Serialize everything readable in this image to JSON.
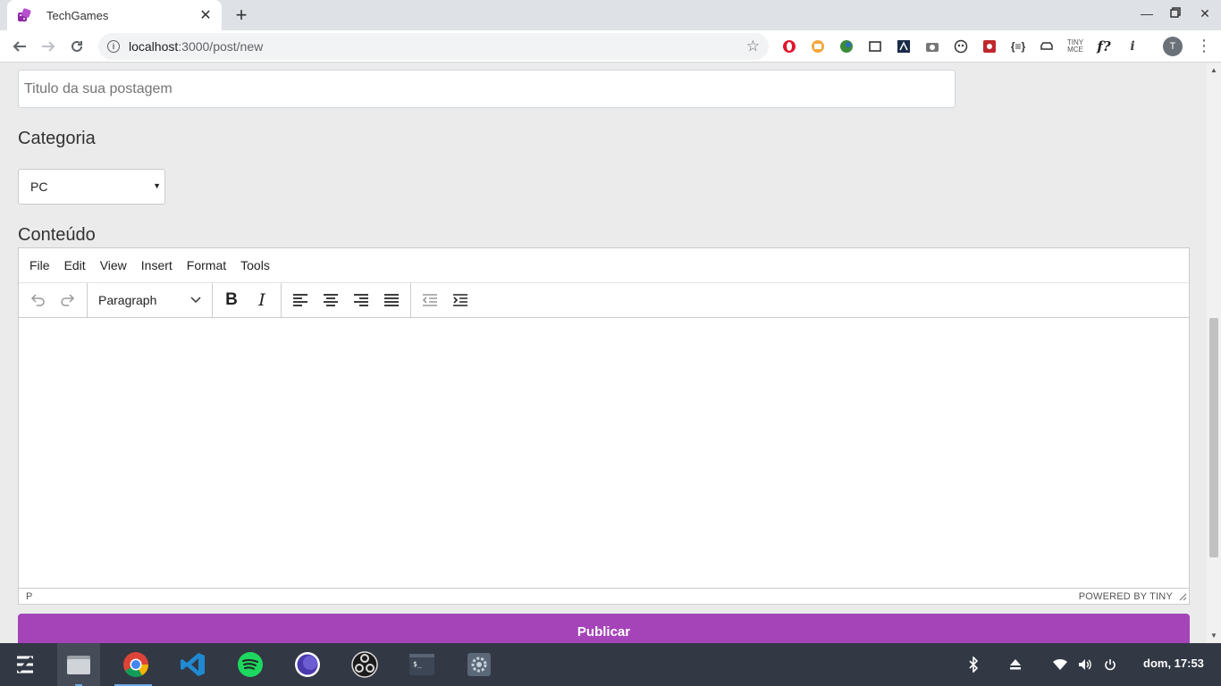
{
  "browser": {
    "tab_title": "TechGames",
    "url_host": "localhost",
    "url_path": ":3000/post/new",
    "avatar_letter": "T"
  },
  "page": {
    "title_placeholder": "Titulo da sua postagem",
    "category_label": "Categoria",
    "category_selected": "PC",
    "content_label": "Conteúdo",
    "publish_label": "Publicar"
  },
  "editor": {
    "menu": [
      "File",
      "Edit",
      "View",
      "Insert",
      "Format",
      "Tools"
    ],
    "format_select": "Paragraph",
    "status_path": "P",
    "powered_by": "POWERED BY TINY"
  },
  "taskbar": {
    "clock": "dom, 17:53"
  },
  "colors": {
    "accent": "#a444b8",
    "page_bg": "#ebebeb",
    "taskbar_bg": "#323844"
  }
}
